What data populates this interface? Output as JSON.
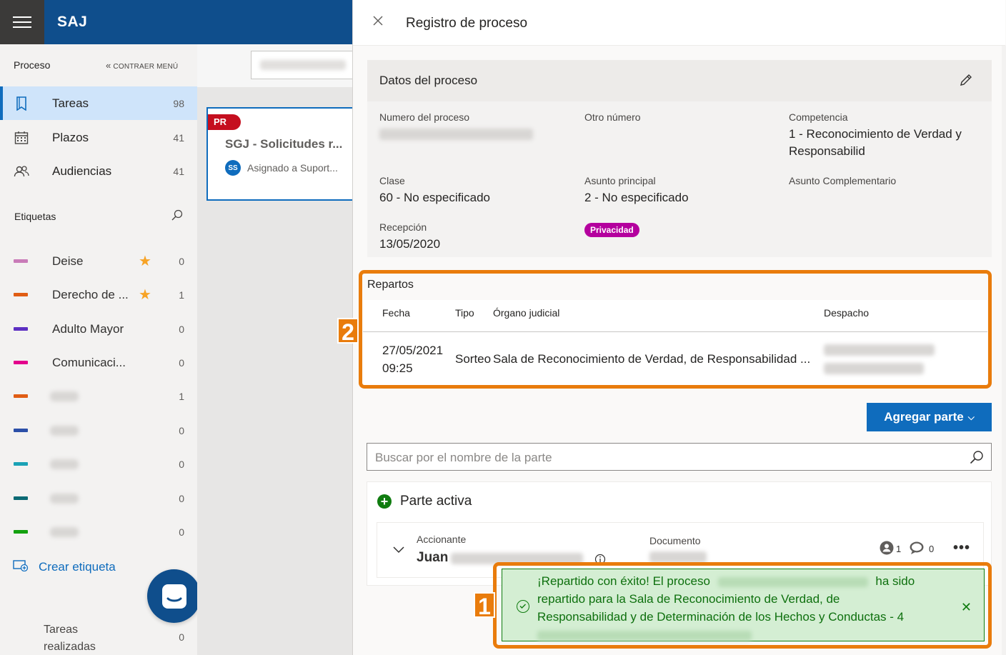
{
  "app": {
    "brand": "SAJ"
  },
  "sidebar": {
    "header": "Proceso",
    "collapse_label": "CONTRAER MENÚ",
    "nav": [
      {
        "label": "Tareas",
        "count": "98",
        "icon": "bookmark-icon",
        "active": true
      },
      {
        "label": "Plazos",
        "count": "41",
        "icon": "calendar-icon",
        "active": false
      },
      {
        "label": "Audiencias",
        "count": "41",
        "icon": "people-icon",
        "active": false
      }
    ],
    "tags_header": "Etiquetas",
    "tags": [
      {
        "label": "Deise",
        "count": "0",
        "color": "#c97bb8",
        "starred": true
      },
      {
        "label": "Derecho de ...",
        "count": "1",
        "color": "#e05d14",
        "starred": true
      },
      {
        "label": "Adulto Mayor",
        "count": "0",
        "color": "#5c2fc2",
        "starred": false
      },
      {
        "label": "Comunicaci...",
        "count": "0",
        "color": "#e3008c",
        "starred": false
      },
      {
        "label": "",
        "count": "1",
        "color": "#e05d14",
        "starred": false
      },
      {
        "label": "",
        "count": "0",
        "color": "#2b4fa8",
        "starred": false
      },
      {
        "label": "",
        "count": "0",
        "color": "#1aa2b5",
        "starred": false
      },
      {
        "label": "",
        "count": "0",
        "color": "#0b6a74",
        "starred": false
      },
      {
        "label": "",
        "count": "0",
        "color": "#13a10e",
        "starred": false
      }
    ],
    "create_tag": "Crear etiqueta",
    "done_label": "Tareas realizadas",
    "done_count": "0"
  },
  "card": {
    "badge": "PR",
    "title": "SGJ - Solicitudes r...",
    "avatar": "SS",
    "assigned": "Asignado a Suport..."
  },
  "panel": {
    "title": "Registro de proceso",
    "datos": {
      "title": "Datos del proceso",
      "numero_label": "Numero del proceso",
      "otro_label": "Otro número",
      "competencia_label": "Competencia",
      "competencia_value": "1 - Reconocimiento de Verdad y Responsabilid",
      "clase_label": "Clase",
      "clase_value": "60 - No especificado",
      "asunto_label": "Asunto principal",
      "asunto_value": "2 - No especificado",
      "complementario_label": "Asunto Complementario",
      "recepcion_label": "Recepción",
      "recepcion_value": "13/05/2020",
      "privacidad": "Privacidad"
    },
    "repartos": {
      "title": "Repartos",
      "headers": [
        "Fecha",
        "Tipo",
        "Órgano judicial",
        "Despacho"
      ],
      "row": {
        "fecha": "27/05/2021",
        "hora": "09:25",
        "tipo": "Sorteo",
        "organo": "Sala de Reconocimiento de Verdad, de Responsabilidad ..."
      }
    },
    "agregar_parte": "Agregar parte",
    "search_placeholder": "Buscar por el nombre de la parte",
    "parte_activa": {
      "title": "Parte activa",
      "role_label": "Accionante",
      "name": "Juan",
      "doc_label": "Documento",
      "count_people": "1",
      "count_comments": "0"
    },
    "toast": {
      "line1a": "¡Repartido con éxito! El proceso",
      "line1b": "ha sido",
      "line2": "repartido para la Sala de Reconocimiento de Verdad, de",
      "line3": "Responsabilidad y de Determinación de los Hechos y Conductas - 4"
    }
  },
  "annotations": {
    "first": "1",
    "second": "2",
    "color": "#e97c0c"
  }
}
